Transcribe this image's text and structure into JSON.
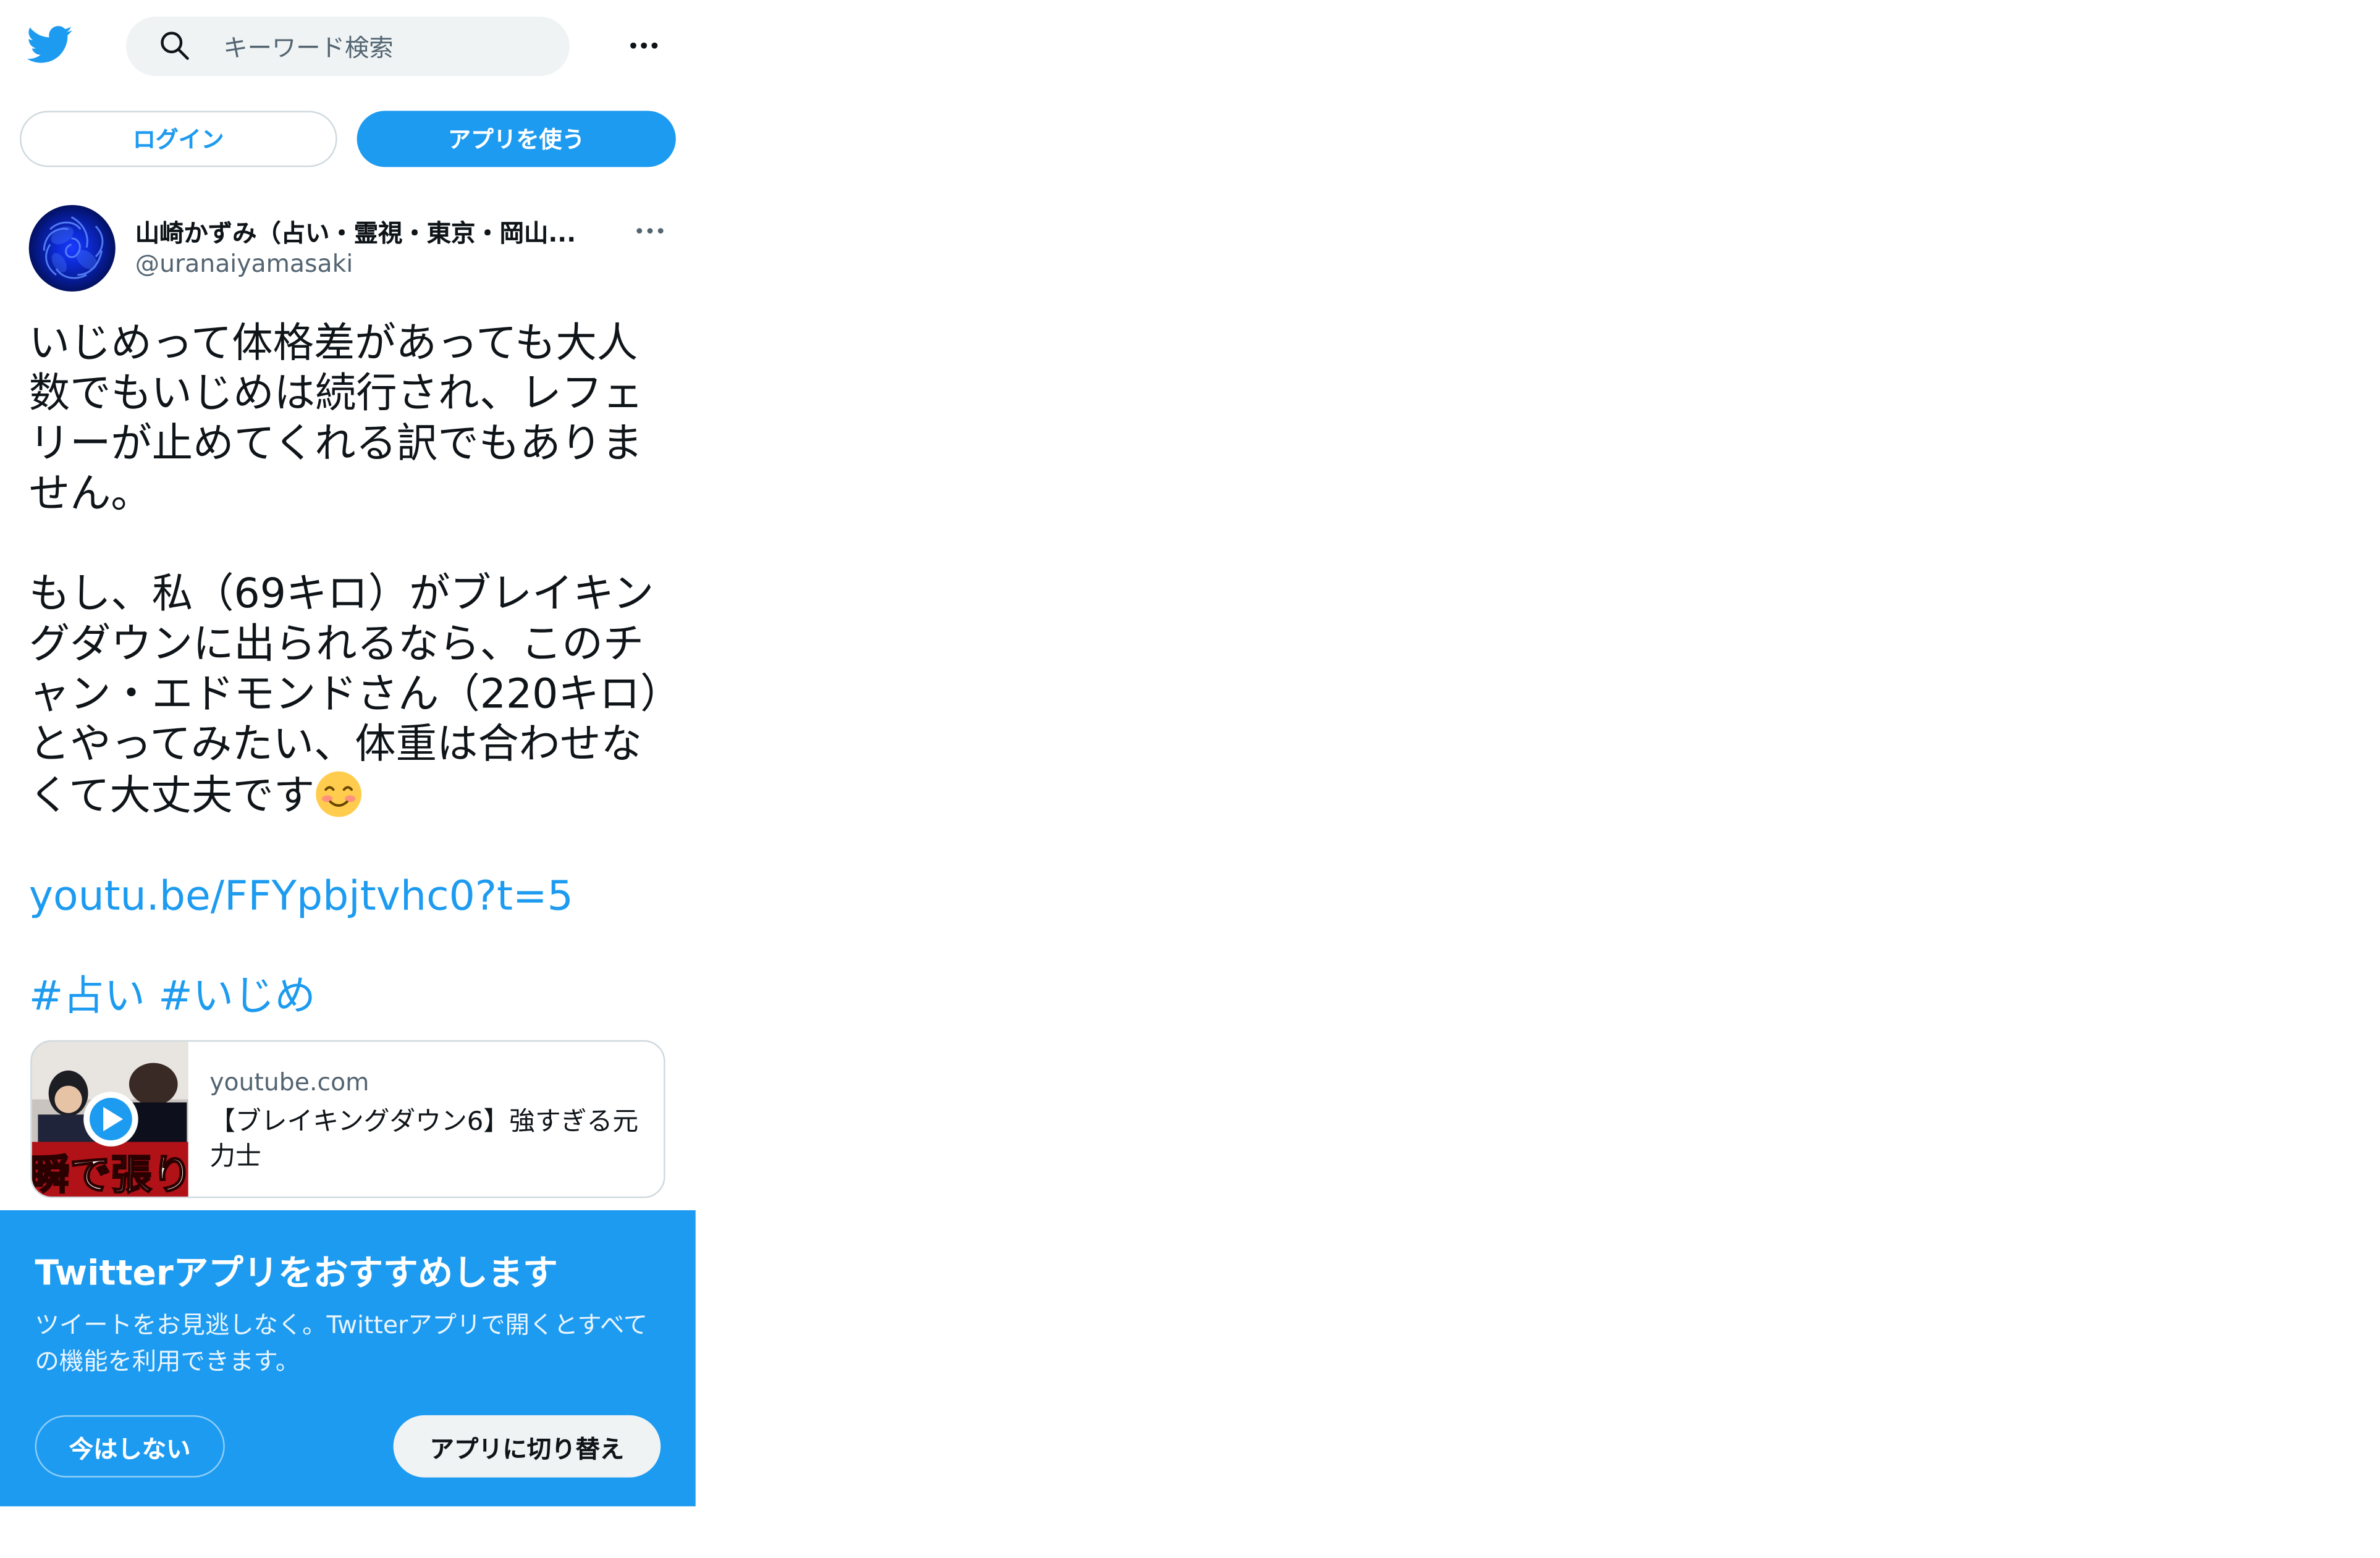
{
  "header": {
    "logo_icon": "twitter-bird-icon",
    "search_placeholder": "キーワード検索",
    "more_icon": "more-horizontal-icon"
  },
  "auth": {
    "login_label": "ログイン",
    "use_app_label": "アプリを使う"
  },
  "tweet": {
    "author_name": "山崎かずみ（占い・霊視・東京・岡山...",
    "author_handle": "@uranaiyamasaki",
    "body_para1": "いじめって体格差があっても大人数でもいじめは続行され、レフェリーが止めてくれる訳でもありません。",
    "body_para2": "もし、私（69キロ）がブレイキングダウンに出られるなら、このチャン・エドモンドさん（220キロ）とやってみたい、体重は合わせなくて大丈夫です",
    "emoji_icon": "smiling-face-icon",
    "link_text": "youtu.be/FFYpbjtvhc0?t=5",
    "hashtags": [
      "#占い",
      "#いじめ"
    ],
    "card": {
      "domain": "youtube.com",
      "title": "【ブレイキングダウン6】強すぎる元力士",
      "thumbnail_caption": "瞬で張り倒"
    }
  },
  "promo": {
    "title": "Twitterアプリをおすすめします",
    "text": "ツイートをお見逃しなく。Twitterアプリで開くとすべての機能を利用できます。",
    "not_now_label": "今はしない",
    "switch_label": "アプリに切り替え"
  },
  "colors": {
    "brand_blue": "#1d9bf0",
    "text_primary": "#0f1419",
    "text_secondary": "#536471",
    "search_bg": "#eff3f4"
  }
}
